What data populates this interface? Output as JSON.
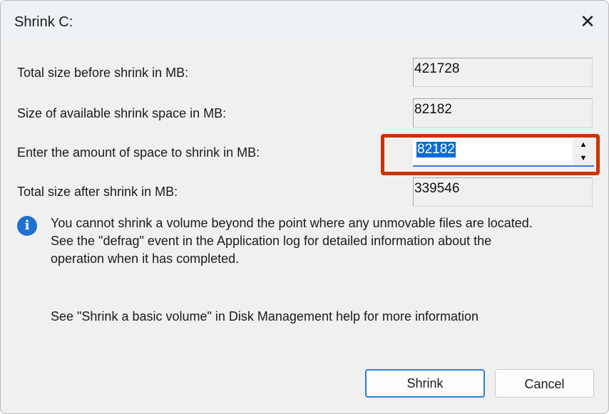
{
  "dialog": {
    "title": "Shrink C:",
    "close_icon": "close-icon"
  },
  "fields": {
    "total_before": {
      "label": "Total size before shrink in MB:",
      "value": "421728"
    },
    "available": {
      "label": "Size of available shrink space in MB:",
      "value": "82182"
    },
    "amount": {
      "label": "Enter the amount of space to shrink in MB:",
      "value": "82182"
    },
    "total_after": {
      "label": "Total size after shrink in MB:",
      "value": "339546"
    }
  },
  "info": {
    "icon": "info-icon",
    "lines": [
      "You cannot shrink a volume beyond the point where any unmovable files are located.",
      "See the \"defrag\" event in the Application log for detailed information about the",
      "operation when it has completed."
    ]
  },
  "note": "See \"Shrink a basic volume\" in Disk Management help for more information",
  "buttons": {
    "shrink": "Shrink",
    "cancel": "Cancel"
  },
  "highlight_color": "#cc3300"
}
